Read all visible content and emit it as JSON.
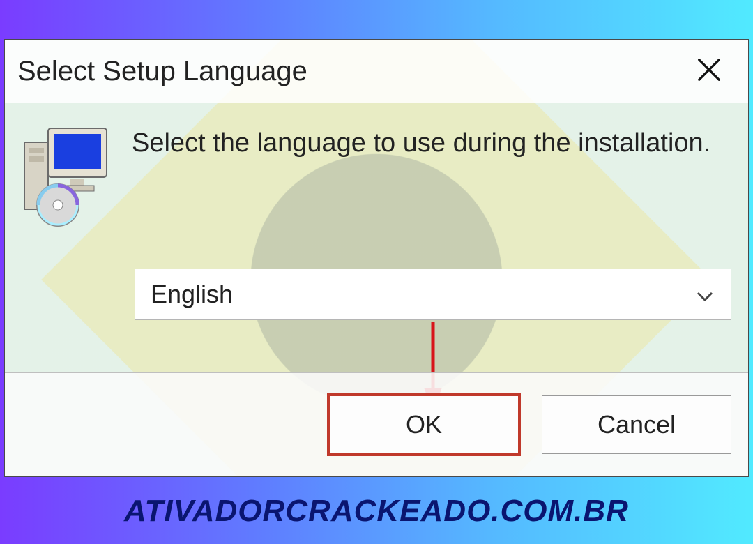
{
  "dialog": {
    "title": "Select Setup Language",
    "instruction": "Select the language to use during the installation.",
    "language_value": "English",
    "ok_label": "OK",
    "cancel_label": "Cancel"
  },
  "icons": {
    "close": "close-icon",
    "chevron": "chevron-down-icon",
    "setup": "installer-icon"
  },
  "annotation": {
    "arrow_color": "#d8131a",
    "highlight_color": "#c0392b"
  },
  "caption": "ATIVADORCRACKEADO.COM.BR"
}
